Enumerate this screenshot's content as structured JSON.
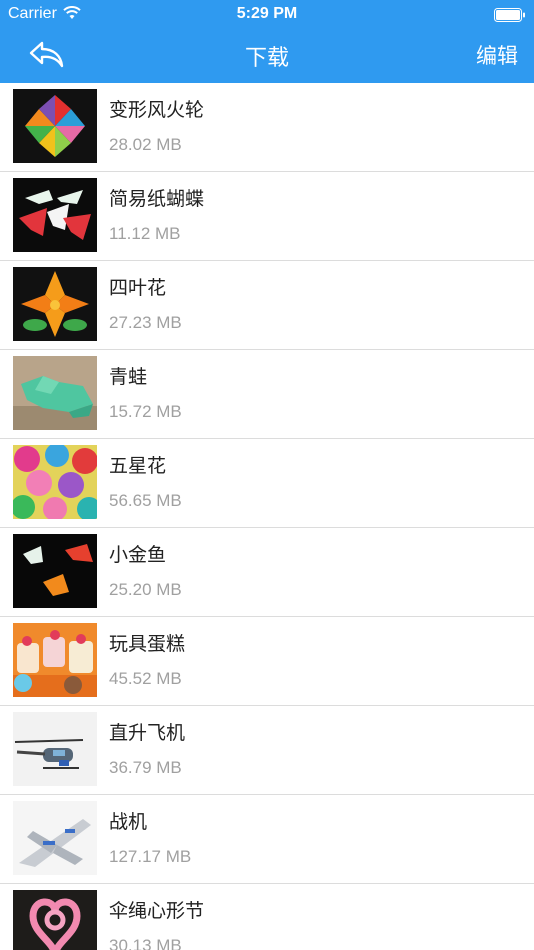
{
  "status": {
    "carrier": "Carrier",
    "time": "5:29 PM"
  },
  "nav": {
    "title": "下载",
    "edit_label": "编辑"
  },
  "items": [
    {
      "name": "变形风火轮",
      "size": "28.02 MB"
    },
    {
      "name": "简易纸蝴蝶",
      "size": "11.12 MB"
    },
    {
      "name": "四叶花",
      "size": "27.23 MB"
    },
    {
      "name": "青蛙",
      "size": "15.72 MB"
    },
    {
      "name": "五星花",
      "size": "56.65 MB"
    },
    {
      "name": "小金鱼",
      "size": "25.20 MB"
    },
    {
      "name": "玩具蛋糕",
      "size": "45.52 MB"
    },
    {
      "name": "直升飞机",
      "size": "36.79 MB"
    },
    {
      "name": "战机",
      "size": "127.17 MB"
    },
    {
      "name": "伞绳心形节",
      "size": "30.13 MB"
    }
  ],
  "colors": {
    "navbar": "#2f9af0",
    "secondary_text": "#a0a0a0"
  }
}
